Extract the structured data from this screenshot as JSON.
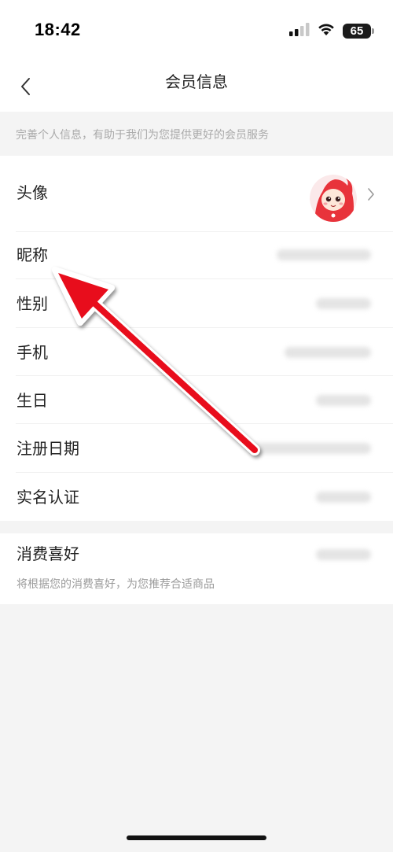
{
  "status_bar": {
    "time": "18:42",
    "battery": "65",
    "icons": [
      "cellular-signal-icon",
      "wifi-icon",
      "battery-icon"
    ]
  },
  "nav": {
    "title": "会员信息",
    "back_icon": "chevron-left-icon"
  },
  "hint": "完善个人信息，有助于我们为您提供更好的会员服务",
  "profile_rows": [
    {
      "label": "头像"
    },
    {
      "label": "昵称"
    },
    {
      "label": "性别"
    },
    {
      "label": "手机"
    },
    {
      "label": "生日"
    },
    {
      "label": "注册日期"
    },
    {
      "label": "实名认证"
    }
  ],
  "preference": {
    "label": "消费喜好",
    "subtitle": "将根据您的消费喜好，为您推荐合适商品"
  },
  "colors": {
    "background": "#f4f4f4",
    "card": "#ffffff",
    "annotation_arrow": "#e8101a",
    "avatar_red": "#e8333b"
  }
}
